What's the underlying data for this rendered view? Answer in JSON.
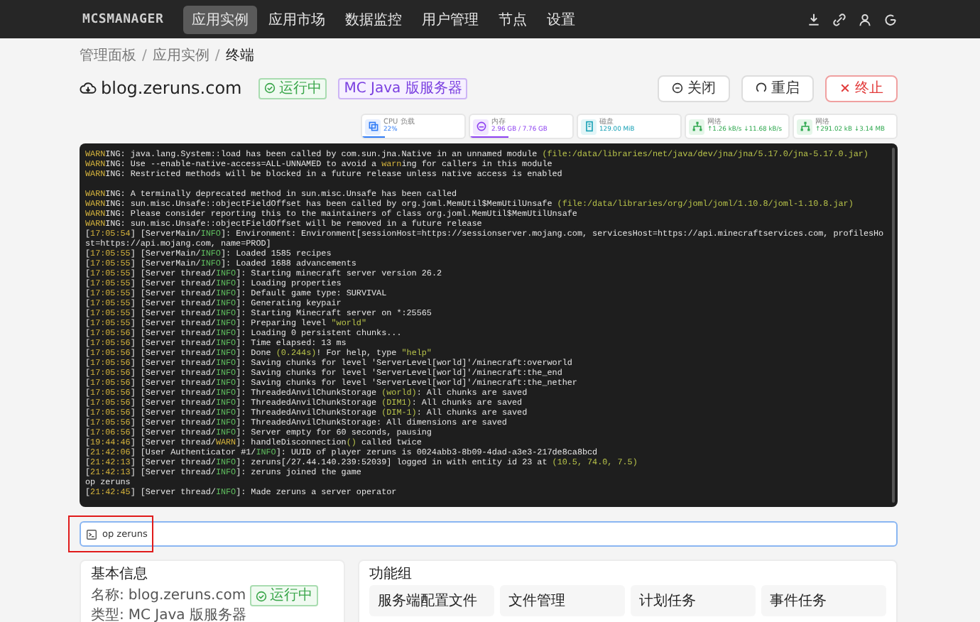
{
  "nav": {
    "logo": "MCSMANAGER",
    "items": [
      {
        "label": "应用实例",
        "selected": true
      },
      {
        "label": "应用市场",
        "selected": false
      },
      {
        "label": "数据监控",
        "selected": false
      },
      {
        "label": "用户管理",
        "selected": false
      },
      {
        "label": "节点",
        "selected": false
      },
      {
        "label": "设置",
        "selected": false
      }
    ]
  },
  "breadcrumb": [
    "管理面板",
    "应用实例",
    "终端"
  ],
  "breadcrumb_separator": "/",
  "instance": {
    "name": "blog.zeruns.com",
    "status": "运行中",
    "type_tag": "MC Java 版服务器"
  },
  "actions": [
    {
      "label": "关闭",
      "kind": "stop"
    },
    {
      "label": "重启",
      "kind": "restart"
    },
    {
      "label": "终止",
      "kind": "kill"
    }
  ],
  "stats": [
    {
      "kind": "cpu",
      "label": "CPU 负载",
      "value": "22%",
      "level": 0.22
    },
    {
      "kind": "memory",
      "label": "内存",
      "value": "2.96 GB / 7.76 GB",
      "level": 0.38
    },
    {
      "kind": "disk",
      "label": "磁盘",
      "value": "129.00 MiB"
    },
    {
      "kind": "network",
      "label": "网络",
      "value": "↑1.26 kB/s ↓11.68 kB/s"
    },
    {
      "kind": "network",
      "label": "网络",
      "value": "↑291.02 kB ↓3.14 MB"
    }
  ],
  "terminal": {
    "lines": [
      {
        "kind": "log",
        "parts": [
          {
            "kind": "warn",
            "text": "WARN"
          },
          {
            "kind": "plain",
            "text": "ING: java.lang.System::load has been called by com.sun.jna.Native in an unnamed module "
          },
          {
            "kind": "accent",
            "text": "(file:/data/libraries/net/java/dev/jna/jna/5.17.0/jna-5.17.0.jar)"
          }
        ]
      },
      {
        "kind": "log",
        "parts": [
          {
            "kind": "warn",
            "text": "WARN"
          },
          {
            "kind": "plain",
            "text": "ING: Use --enable-native-access=ALL-UNNAMED to avoid a "
          },
          {
            "kind": "warn",
            "text": "warn"
          },
          {
            "kind": "plain",
            "text": "ing for callers in this module"
          }
        ]
      },
      {
        "kind": "log",
        "parts": [
          {
            "kind": "warn",
            "text": "WARN"
          },
          {
            "kind": "plain",
            "text": "ING: Restricted methods will be blocked in a future release unless native access is enabled"
          }
        ]
      },
      {
        "kind": "blank"
      },
      {
        "kind": "log",
        "parts": [
          {
            "kind": "warn",
            "text": "WARN"
          },
          {
            "kind": "plain",
            "text": "ING: A terminally deprecated method in sun.misc.Unsafe has been called"
          }
        ]
      },
      {
        "kind": "log",
        "parts": [
          {
            "kind": "warn",
            "text": "WARN"
          },
          {
            "kind": "plain",
            "text": "ING: sun.misc.Unsafe::objectFieldOffset has been called by org.joml.MemUtil$MemUtilUnsafe "
          },
          {
            "kind": "accent",
            "text": "(file:/data/libraries/org/joml/joml/1.10.8/joml-1.10.8.jar)"
          }
        ]
      },
      {
        "kind": "log",
        "parts": [
          {
            "kind": "warn",
            "text": "WARN"
          },
          {
            "kind": "plain",
            "text": "ING: Please consider reporting this to the maintainers of class org.joml.MemUtil$MemUtilUnsafe"
          }
        ]
      },
      {
        "kind": "log",
        "parts": [
          {
            "kind": "warn",
            "text": "WARN"
          },
          {
            "kind": "plain",
            "text": "ING: sun.misc.Unsafe::objectFieldOffset will be removed in a future release"
          }
        ]
      },
      {
        "kind": "log",
        "parts": [
          {
            "kind": "plain",
            "text": "["
          },
          {
            "kind": "time",
            "text": "17:05:54"
          },
          {
            "kind": "plain",
            "text": "] [ServerMain/"
          },
          {
            "kind": "info",
            "text": "INFO"
          },
          {
            "kind": "plain",
            "text": "]: Environment: Environment[sessionHost=https://sessionserver.mojang.com, servicesHost=https://api.minecraftservices.com, profilesHost=https://api.mojang.com, name=PROD]"
          }
        ]
      },
      {
        "kind": "log",
        "parts": [
          {
            "kind": "plain",
            "text": "["
          },
          {
            "kind": "time",
            "text": "17:05:55"
          },
          {
            "kind": "plain",
            "text": "] [ServerMain/"
          },
          {
            "kind": "info",
            "text": "INFO"
          },
          {
            "kind": "plain",
            "text": "]: Loaded 1585 recipes"
          }
        ]
      },
      {
        "kind": "log",
        "parts": [
          {
            "kind": "plain",
            "text": "["
          },
          {
            "kind": "time",
            "text": "17:05:55"
          },
          {
            "kind": "plain",
            "text": "] [ServerMain/"
          },
          {
            "kind": "info",
            "text": "INFO"
          },
          {
            "kind": "plain",
            "text": "]: Loaded 1688 advancements"
          }
        ]
      },
      {
        "kind": "log",
        "parts": [
          {
            "kind": "plain",
            "text": "["
          },
          {
            "kind": "time",
            "text": "17:05:55"
          },
          {
            "kind": "plain",
            "text": "] [Server thread/"
          },
          {
            "kind": "info",
            "text": "INFO"
          },
          {
            "kind": "plain",
            "text": "]: Starting minecraft server version 26.2"
          }
        ]
      },
      {
        "kind": "log",
        "parts": [
          {
            "kind": "plain",
            "text": "["
          },
          {
            "kind": "time",
            "text": "17:05:55"
          },
          {
            "kind": "plain",
            "text": "] [Server thread/"
          },
          {
            "kind": "info",
            "text": "INFO"
          },
          {
            "kind": "plain",
            "text": "]: Loading properties"
          }
        ]
      },
      {
        "kind": "log",
        "parts": [
          {
            "kind": "plain",
            "text": "["
          },
          {
            "kind": "time",
            "text": "17:05:55"
          },
          {
            "kind": "plain",
            "text": "] [Server thread/"
          },
          {
            "kind": "info",
            "text": "INFO"
          },
          {
            "kind": "plain",
            "text": "]: Default game type: SURVIVAL"
          }
        ]
      },
      {
        "kind": "log",
        "parts": [
          {
            "kind": "plain",
            "text": "["
          },
          {
            "kind": "time",
            "text": "17:05:55"
          },
          {
            "kind": "plain",
            "text": "] [Server thread/"
          },
          {
            "kind": "info",
            "text": "INFO"
          },
          {
            "kind": "plain",
            "text": "]: Generating keypair"
          }
        ]
      },
      {
        "kind": "log",
        "parts": [
          {
            "kind": "plain",
            "text": "["
          },
          {
            "kind": "time",
            "text": "17:05:55"
          },
          {
            "kind": "plain",
            "text": "] [Server thread/"
          },
          {
            "kind": "info",
            "text": "INFO"
          },
          {
            "kind": "plain",
            "text": "]: Starting Minecraft server on *:25565"
          }
        ]
      },
      {
        "kind": "log",
        "parts": [
          {
            "kind": "plain",
            "text": "["
          },
          {
            "kind": "time",
            "text": "17:05:55"
          },
          {
            "kind": "plain",
            "text": "] [Server thread/"
          },
          {
            "kind": "info",
            "text": "INFO"
          },
          {
            "kind": "plain",
            "text": "]: Preparing level "
          },
          {
            "kind": "accent",
            "text": "\"world\""
          }
        ]
      },
      {
        "kind": "log",
        "parts": [
          {
            "kind": "plain",
            "text": "["
          },
          {
            "kind": "time",
            "text": "17:05:56"
          },
          {
            "kind": "plain",
            "text": "] [Server thread/"
          },
          {
            "kind": "info",
            "text": "INFO"
          },
          {
            "kind": "plain",
            "text": "]: Loading 0 persistent chunks..."
          }
        ]
      },
      {
        "kind": "log",
        "parts": [
          {
            "kind": "plain",
            "text": "["
          },
          {
            "kind": "time",
            "text": "17:05:56"
          },
          {
            "kind": "plain",
            "text": "] [Server thread/"
          },
          {
            "kind": "info",
            "text": "INFO"
          },
          {
            "kind": "plain",
            "text": "]: Time elapsed: 13 ms"
          }
        ]
      },
      {
        "kind": "log",
        "parts": [
          {
            "kind": "plain",
            "text": "["
          },
          {
            "kind": "time",
            "text": "17:05:56"
          },
          {
            "kind": "plain",
            "text": "] [Server thread/"
          },
          {
            "kind": "info",
            "text": "INFO"
          },
          {
            "kind": "plain",
            "text": "]: Done "
          },
          {
            "kind": "accent",
            "text": "(0.244s)"
          },
          {
            "kind": "plain",
            "text": "! For help, type "
          },
          {
            "kind": "accent",
            "text": "\"help\""
          }
        ]
      },
      {
        "kind": "log",
        "parts": [
          {
            "kind": "plain",
            "text": "["
          },
          {
            "kind": "time",
            "text": "17:05:56"
          },
          {
            "kind": "plain",
            "text": "] [Server thread/"
          },
          {
            "kind": "info",
            "text": "INFO"
          },
          {
            "kind": "plain",
            "text": "]: Saving chunks for level 'ServerLevel[world]'/minecraft:overworld"
          }
        ]
      },
      {
        "kind": "log",
        "parts": [
          {
            "kind": "plain",
            "text": "["
          },
          {
            "kind": "time",
            "text": "17:05:56"
          },
          {
            "kind": "plain",
            "text": "] [Server thread/"
          },
          {
            "kind": "info",
            "text": "INFO"
          },
          {
            "kind": "plain",
            "text": "]: Saving chunks for level 'ServerLevel[world]'/minecraft:the_end"
          }
        ]
      },
      {
        "kind": "log",
        "parts": [
          {
            "kind": "plain",
            "text": "["
          },
          {
            "kind": "time",
            "text": "17:05:56"
          },
          {
            "kind": "plain",
            "text": "] [Server thread/"
          },
          {
            "kind": "info",
            "text": "INFO"
          },
          {
            "kind": "plain",
            "text": "]: Saving chunks for level 'ServerLevel[world]'/minecraft:the_nether"
          }
        ]
      },
      {
        "kind": "log",
        "parts": [
          {
            "kind": "plain",
            "text": "["
          },
          {
            "kind": "time",
            "text": "17:05:56"
          },
          {
            "kind": "plain",
            "text": "] [Server thread/"
          },
          {
            "kind": "info",
            "text": "INFO"
          },
          {
            "kind": "plain",
            "text": "]: ThreadedAnvilChunkStorage "
          },
          {
            "kind": "accent",
            "text": "(world)"
          },
          {
            "kind": "plain",
            "text": ": All chunks are saved"
          }
        ]
      },
      {
        "kind": "log",
        "parts": [
          {
            "kind": "plain",
            "text": "["
          },
          {
            "kind": "time",
            "text": "17:05:56"
          },
          {
            "kind": "plain",
            "text": "] [Server thread/"
          },
          {
            "kind": "info",
            "text": "INFO"
          },
          {
            "kind": "plain",
            "text": "]: ThreadedAnvilChunkStorage "
          },
          {
            "kind": "accent",
            "text": "(DIM1)"
          },
          {
            "kind": "plain",
            "text": ": All chunks are saved"
          }
        ]
      },
      {
        "kind": "log",
        "parts": [
          {
            "kind": "plain",
            "text": "["
          },
          {
            "kind": "time",
            "text": "17:05:56"
          },
          {
            "kind": "plain",
            "text": "] [Server thread/"
          },
          {
            "kind": "info",
            "text": "INFO"
          },
          {
            "kind": "plain",
            "text": "]: ThreadedAnvilChunkStorage "
          },
          {
            "kind": "accent",
            "text": "(DIM-1)"
          },
          {
            "kind": "plain",
            "text": ": All chunks are saved"
          }
        ]
      },
      {
        "kind": "log",
        "parts": [
          {
            "kind": "plain",
            "text": "["
          },
          {
            "kind": "time",
            "text": "17:05:56"
          },
          {
            "kind": "plain",
            "text": "] [Server thread/"
          },
          {
            "kind": "info",
            "text": "INFO"
          },
          {
            "kind": "plain",
            "text": "]: ThreadedAnvilChunkStorage: All dimensions are saved"
          }
        ]
      },
      {
        "kind": "log",
        "parts": [
          {
            "kind": "plain",
            "text": "["
          },
          {
            "kind": "time",
            "text": "17:06:56"
          },
          {
            "kind": "plain",
            "text": "] [Server thread/"
          },
          {
            "kind": "info",
            "text": "INFO"
          },
          {
            "kind": "plain",
            "text": "]: Server empty for 60 seconds, pausing"
          }
        ]
      },
      {
        "kind": "log",
        "parts": [
          {
            "kind": "plain",
            "text": "["
          },
          {
            "kind": "time",
            "text": "19:44:46"
          },
          {
            "kind": "plain",
            "text": "] [Server thread/"
          },
          {
            "kind": "warn",
            "text": "WARN"
          },
          {
            "kind": "plain",
            "text": "]: handleDisconnection"
          },
          {
            "kind": "accent",
            "text": "()"
          },
          {
            "kind": "plain",
            "text": " called twice"
          }
        ]
      },
      {
        "kind": "log",
        "parts": [
          {
            "kind": "plain",
            "text": "["
          },
          {
            "kind": "time",
            "text": "21:42:06"
          },
          {
            "kind": "plain",
            "text": "] [User Authenticator #1/"
          },
          {
            "kind": "info",
            "text": "INFO"
          },
          {
            "kind": "plain",
            "text": "]: UUID of player zeruns is 0024abb3-8b09-4dad-a3e3-217de8ca8bcd"
          }
        ]
      },
      {
        "kind": "log",
        "parts": [
          {
            "kind": "plain",
            "text": "["
          },
          {
            "kind": "time",
            "text": "21:42:13"
          },
          {
            "kind": "plain",
            "text": "] [Server thread/"
          },
          {
            "kind": "info",
            "text": "INFO"
          },
          {
            "kind": "plain",
            "text": "]: zeruns[/27.44.140.239:52039] logged in with entity id 23 at "
          },
          {
            "kind": "accent",
            "text": "(10.5, 74.0, 7.5)"
          }
        ]
      },
      {
        "kind": "log",
        "parts": [
          {
            "kind": "plain",
            "text": "["
          },
          {
            "kind": "time",
            "text": "21:42:13"
          },
          {
            "kind": "plain",
            "text": "] [Server thread/"
          },
          {
            "kind": "info",
            "text": "INFO"
          },
          {
            "kind": "plain",
            "text": "]: zeruns joined the game"
          }
        ]
      },
      {
        "kind": "log",
        "parts": [
          {
            "kind": "plain",
            "text": "op zeruns"
          }
        ]
      },
      {
        "kind": "log",
        "parts": [
          {
            "kind": "plain",
            "text": "["
          },
          {
            "kind": "time",
            "text": "21:42:45"
          },
          {
            "kind": "plain",
            "text": "] [Server thread/"
          },
          {
            "kind": "info",
            "text": "INFO"
          },
          {
            "kind": "plain",
            "text": "]: Made zeruns a server operator"
          }
        ]
      }
    ]
  },
  "command": {
    "value": "op zeruns"
  },
  "basic_info": {
    "title": "基本信息",
    "rows": [
      {
        "label": "名称:",
        "value": "blog.zeruns.com",
        "status": "运行中"
      },
      {
        "label": "类型:",
        "value": "MC Java 版服务器"
      }
    ]
  },
  "features": {
    "title": "功能组",
    "items": [
      "服务端配置文件",
      "文件管理",
      "计划任务",
      "事件任务"
    ]
  }
}
